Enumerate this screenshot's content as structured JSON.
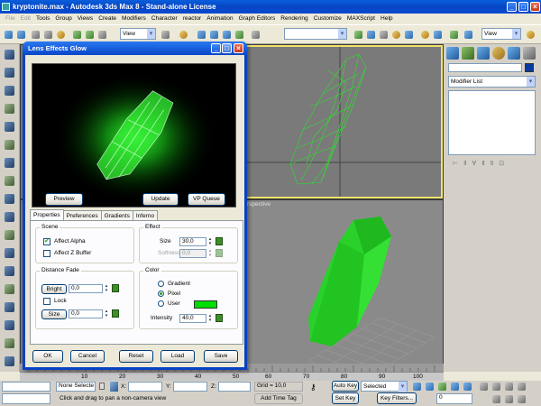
{
  "window": {
    "title": "kryptonite.max - Autodesk 3ds Max 8 - Stand-alone License",
    "minimize": "_",
    "maximize": "□",
    "close": "×"
  },
  "menu": [
    "File",
    "Edit",
    "Tools",
    "Group",
    "Views",
    "Create",
    "Modifiers",
    "Character",
    "reactor",
    "Animation",
    "Graph Editors",
    "Rendering",
    "Customize",
    "MAXScript",
    "Help"
  ],
  "toolbar": {
    "view_combo_1": "View",
    "view_combo_2": "View"
  },
  "dialog": {
    "title": "Lens Effects Glow",
    "buttons": {
      "preview": "Preview",
      "update": "Update",
      "vp_queue": "VP Queue",
      "ok": "OK",
      "cancel": "Cancel",
      "reset": "Reset",
      "load": "Load",
      "save": "Save"
    },
    "tabs": [
      "Properties",
      "Preferences",
      "Gradients",
      "Inferno"
    ],
    "scene": {
      "label": "Scene",
      "affect_alpha": "Affect Alpha",
      "affect_alpha_checked": true,
      "affect_zbuffer": "Affect Z Buffer",
      "affect_zbuffer_checked": false
    },
    "effect": {
      "label": "Effect",
      "size_label": "Size",
      "size_value": "30,0",
      "softness_label": "Softness",
      "softness_value": "0,0"
    },
    "distance_fade": {
      "label": "Distance Fade",
      "bright_label": "Bright",
      "bright_value": "0,0",
      "lock_label": "Lock",
      "size_label": "Size",
      "size_value": "0,0"
    },
    "color": {
      "label": "Color",
      "gradient": "Gradient",
      "pixel": "Pixel",
      "user": "User",
      "selected": "Pixel",
      "swatch": "#00dd00",
      "intensity_label": "Intensity",
      "intensity_value": "40,0"
    }
  },
  "viewports": {
    "perspective_label": "rspective",
    "glow_color": "#29d12a"
  },
  "command_panel": {
    "modifier_list": "Modifier List"
  },
  "timeline": {
    "ticks": [
      "10",
      "20",
      "30",
      "40",
      "50",
      "60",
      "70",
      "80",
      "90",
      "100"
    ]
  },
  "status": {
    "selection": "None Selecte",
    "x_label": "X:",
    "y_label": "Y:",
    "z_label": "Z:",
    "grid": "Grid = 10,0",
    "auto_key": "Auto Key",
    "selected_combo": "Selected",
    "set_key": "Set Key",
    "key_filters": "Key Filters...",
    "frame": "0",
    "prompt": "Click and drag to pan a non-camera view",
    "add_time_tag": "Add Time Tag"
  }
}
